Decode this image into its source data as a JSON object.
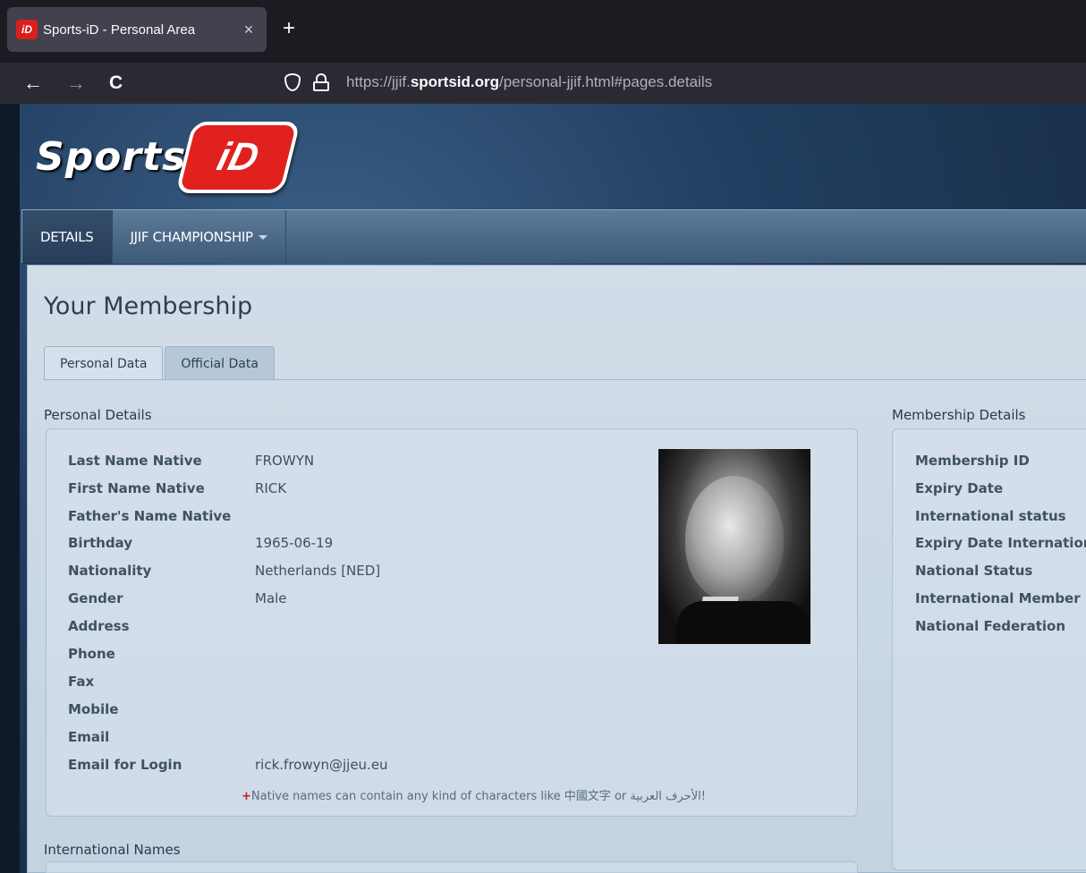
{
  "browser": {
    "tab_title": "Sports-iD - Personal Area",
    "favicon_text": "iD",
    "close_glyph": "×",
    "newtab_glyph": "+",
    "back_glyph": "←",
    "forward_glyph": "→",
    "reload_glyph": "C",
    "url_prefix": "https://jjif.",
    "url_domain": "sportsid.org",
    "url_path": "/personal-jjif.html#pages.details"
  },
  "site": {
    "logo_text": "Sports",
    "logo_badge": "iD",
    "menu": [
      {
        "label": "DETAILS"
      },
      {
        "label": "JJIF CHAMPIONSHIP"
      }
    ]
  },
  "main": {
    "title": "Your Membership",
    "tabs": [
      {
        "label": "Personal Data"
      },
      {
        "label": "Official Data"
      }
    ],
    "personal_section_title": "Personal Details",
    "membership_section_title": "Membership Details",
    "international_section_title": "International Names",
    "personal_fields": [
      {
        "label": "Last Name Native",
        "value": "FROWYN"
      },
      {
        "label": "First Name Native",
        "value": "RICK"
      },
      {
        "label": "Father's Name Native",
        "value": ""
      },
      {
        "label": "Birthday",
        "value": "1965-06-19"
      },
      {
        "label": "Nationality",
        "value": "Netherlands [NED]"
      },
      {
        "label": "Gender",
        "value": "Male"
      },
      {
        "label": "Address",
        "value": ""
      },
      {
        "label": "Phone",
        "value": ""
      },
      {
        "label": "Fax",
        "value": ""
      },
      {
        "label": "Mobile",
        "value": ""
      },
      {
        "label": "Email",
        "value": ""
      },
      {
        "label": "Email for Login",
        "value": "rick.frowyn@jjeu.eu"
      }
    ],
    "membership_fields": [
      {
        "label": "Membership ID"
      },
      {
        "label": "Expiry Date"
      },
      {
        "label": "International status"
      },
      {
        "label": "Expiry Date International"
      },
      {
        "label": "National Status"
      },
      {
        "label": "International Member"
      },
      {
        "label": "National Federation"
      }
    ],
    "note_plus": "+",
    "note_text": "Native names can contain any kind of characters like 中國文字 or الأحرف العربية!"
  }
}
